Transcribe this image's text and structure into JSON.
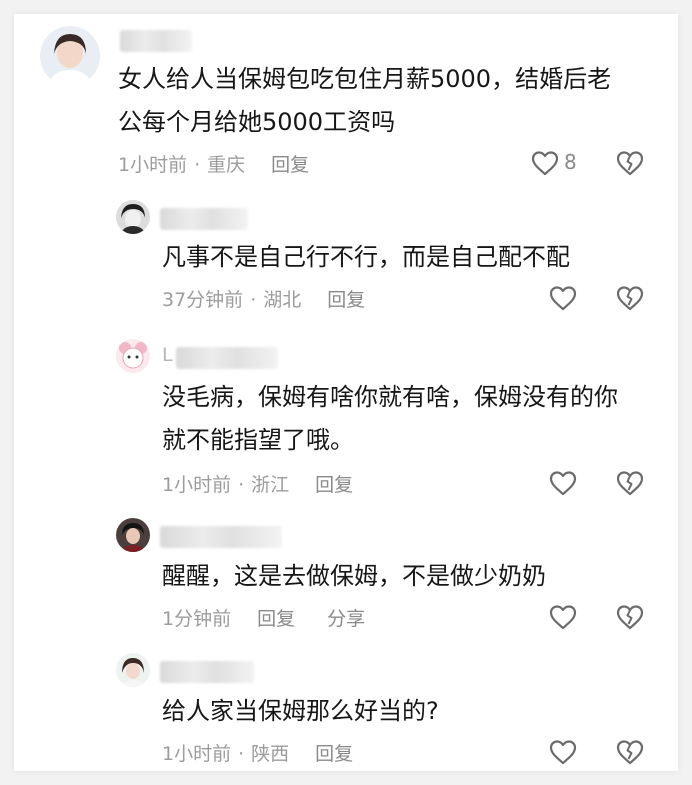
{
  "comments": [
    {
      "text_line1": "女人给人当保姆包吃包住月薪5000，结婚后老",
      "text_line2": "公每个月给她5000工资吗",
      "time": "1小时前",
      "location": "重庆",
      "reply": "回复",
      "likes": "8"
    },
    {
      "text_line1": "凡事不是自己行不行，而是自己配不配",
      "time": "37分钟前",
      "location": "湖北",
      "reply": "回复"
    },
    {
      "name_prefix": "L",
      "text_line1": "没毛病，保姆有啥你就有啥，保姆没有的你",
      "text_line2": "就不能指望了哦。",
      "time": "1小时前",
      "location": "浙江",
      "reply": "回复"
    },
    {
      "text_line1": "醒醒，这是去做保姆，不是做少奶奶",
      "time": "1分钟前",
      "reply": "回复",
      "share": "分享"
    },
    {
      "text_line1": "给人家当保姆那么好当的?",
      "time": "1小时前",
      "location": "陕西",
      "reply": "回复"
    }
  ],
  "icons": {
    "like": "heart-outline-icon",
    "dislike": "broken-heart-icon"
  },
  "colors": {
    "text": "#161616",
    "meta": "#9c9c9c",
    "icon": "#6b6b6b"
  }
}
